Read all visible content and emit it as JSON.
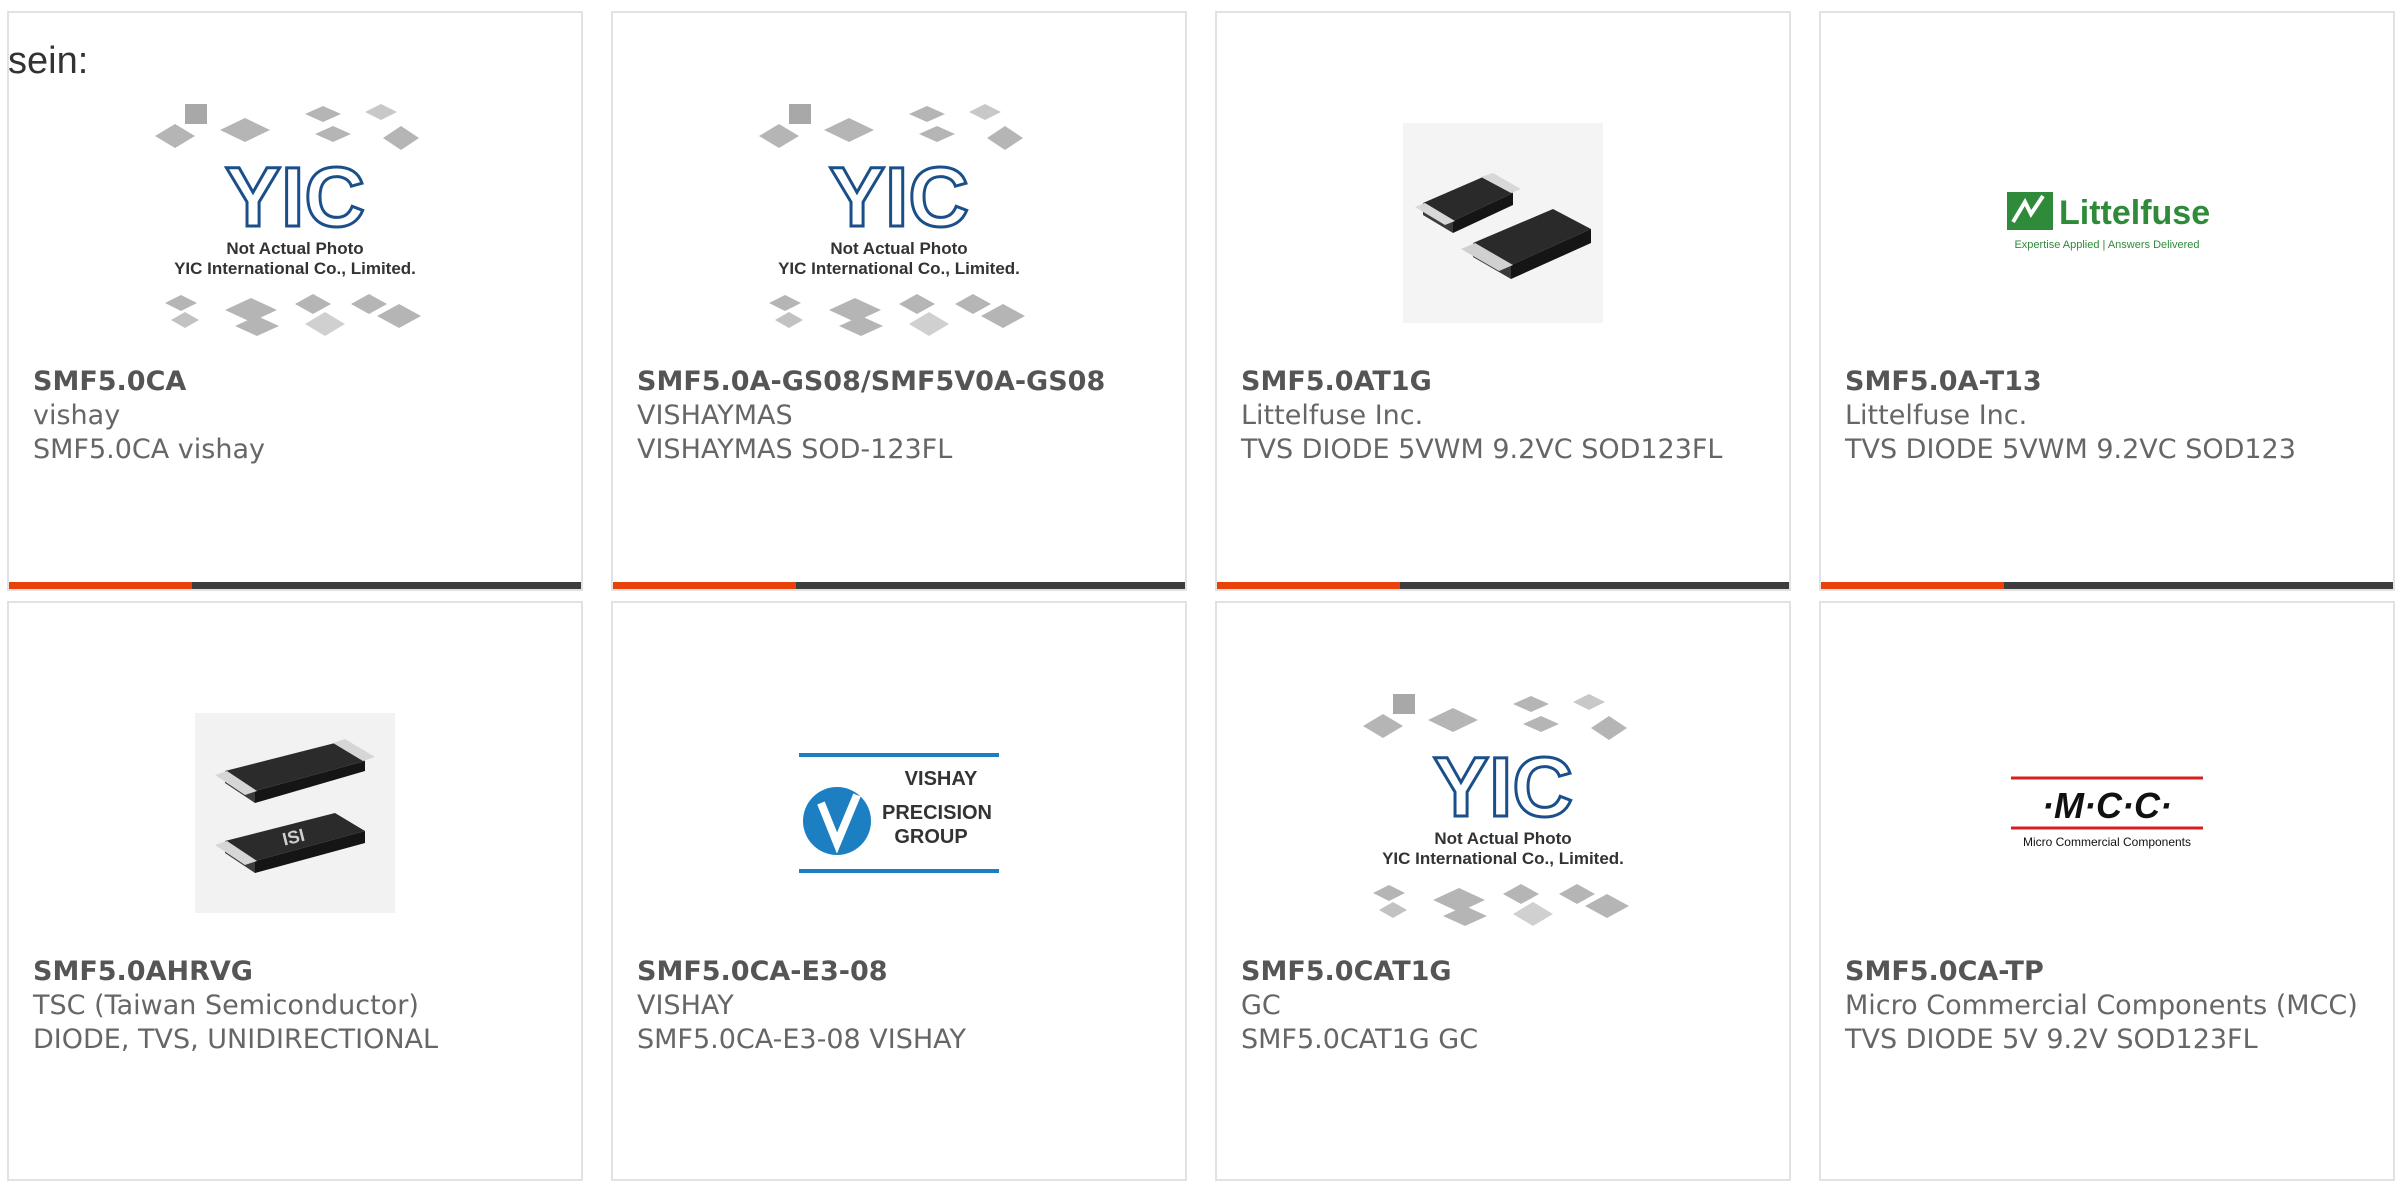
{
  "intro_text": "sein:",
  "colors": {
    "accent": "#e8410a",
    "bar": "#3d3d3d",
    "card_border": "#e2e2e2",
    "text": "#555555"
  },
  "placeholder": {
    "line1": "Not Actual Photo",
    "line2": "YIC International Co., Limited.",
    "logo": "YIC"
  },
  "logos": {
    "littelfuse": {
      "name": "Littelfuse",
      "tagline": "Expertise Applied | Answers Delivered"
    },
    "vishay": {
      "line1": "VISHAY",
      "line2": "PRECISION",
      "line3": "GROUP"
    },
    "mcc": {
      "name": "·M·C·C·",
      "tagline": "Micro Commercial Components"
    }
  },
  "products": [
    {
      "part": "SMF5.0CA",
      "manufacturer": "vishay",
      "description": "SMF5.0CA vishay",
      "image": "yic-placeholder"
    },
    {
      "part": "SMF5.0A-GS08/SMF5V0A-GS08",
      "manufacturer": "VISHAYMAS",
      "description": "VISHAYMAS SOD-123FL",
      "image": "yic-placeholder"
    },
    {
      "part": "SMF5.0AT1G",
      "manufacturer": "Littelfuse Inc.",
      "description": "TVS DIODE 5VWM 9.2VC SOD123FL",
      "image": "diode-photo"
    },
    {
      "part": "SMF5.0A-T13",
      "manufacturer": "Littelfuse Inc.",
      "description": "TVS DIODE 5VWM 9.2VC SOD123",
      "image": "littelfuse-logo"
    },
    {
      "part": "SMF5.0AHRVG",
      "manufacturer": "TSC (Taiwan Semiconductor)",
      "description": "DIODE, TVS, UNIDIRECTIONAL",
      "image": "tsc-diode-photo"
    },
    {
      "part": "SMF5.0CA-E3-08",
      "manufacturer": "VISHAY",
      "description": "SMF5.0CA-E3-08 VISHAY",
      "image": "vishay-logo"
    },
    {
      "part": "SMF5.0CAT1G",
      "manufacturer": "GC",
      "description": "SMF5.0CAT1G GC",
      "image": "yic-placeholder"
    },
    {
      "part": "SMF5.0CA-TP",
      "manufacturer": "Micro Commercial Components (MCC)",
      "description": "TVS DIODE 5V 9.2V SOD123FL",
      "image": "mcc-logo"
    }
  ]
}
